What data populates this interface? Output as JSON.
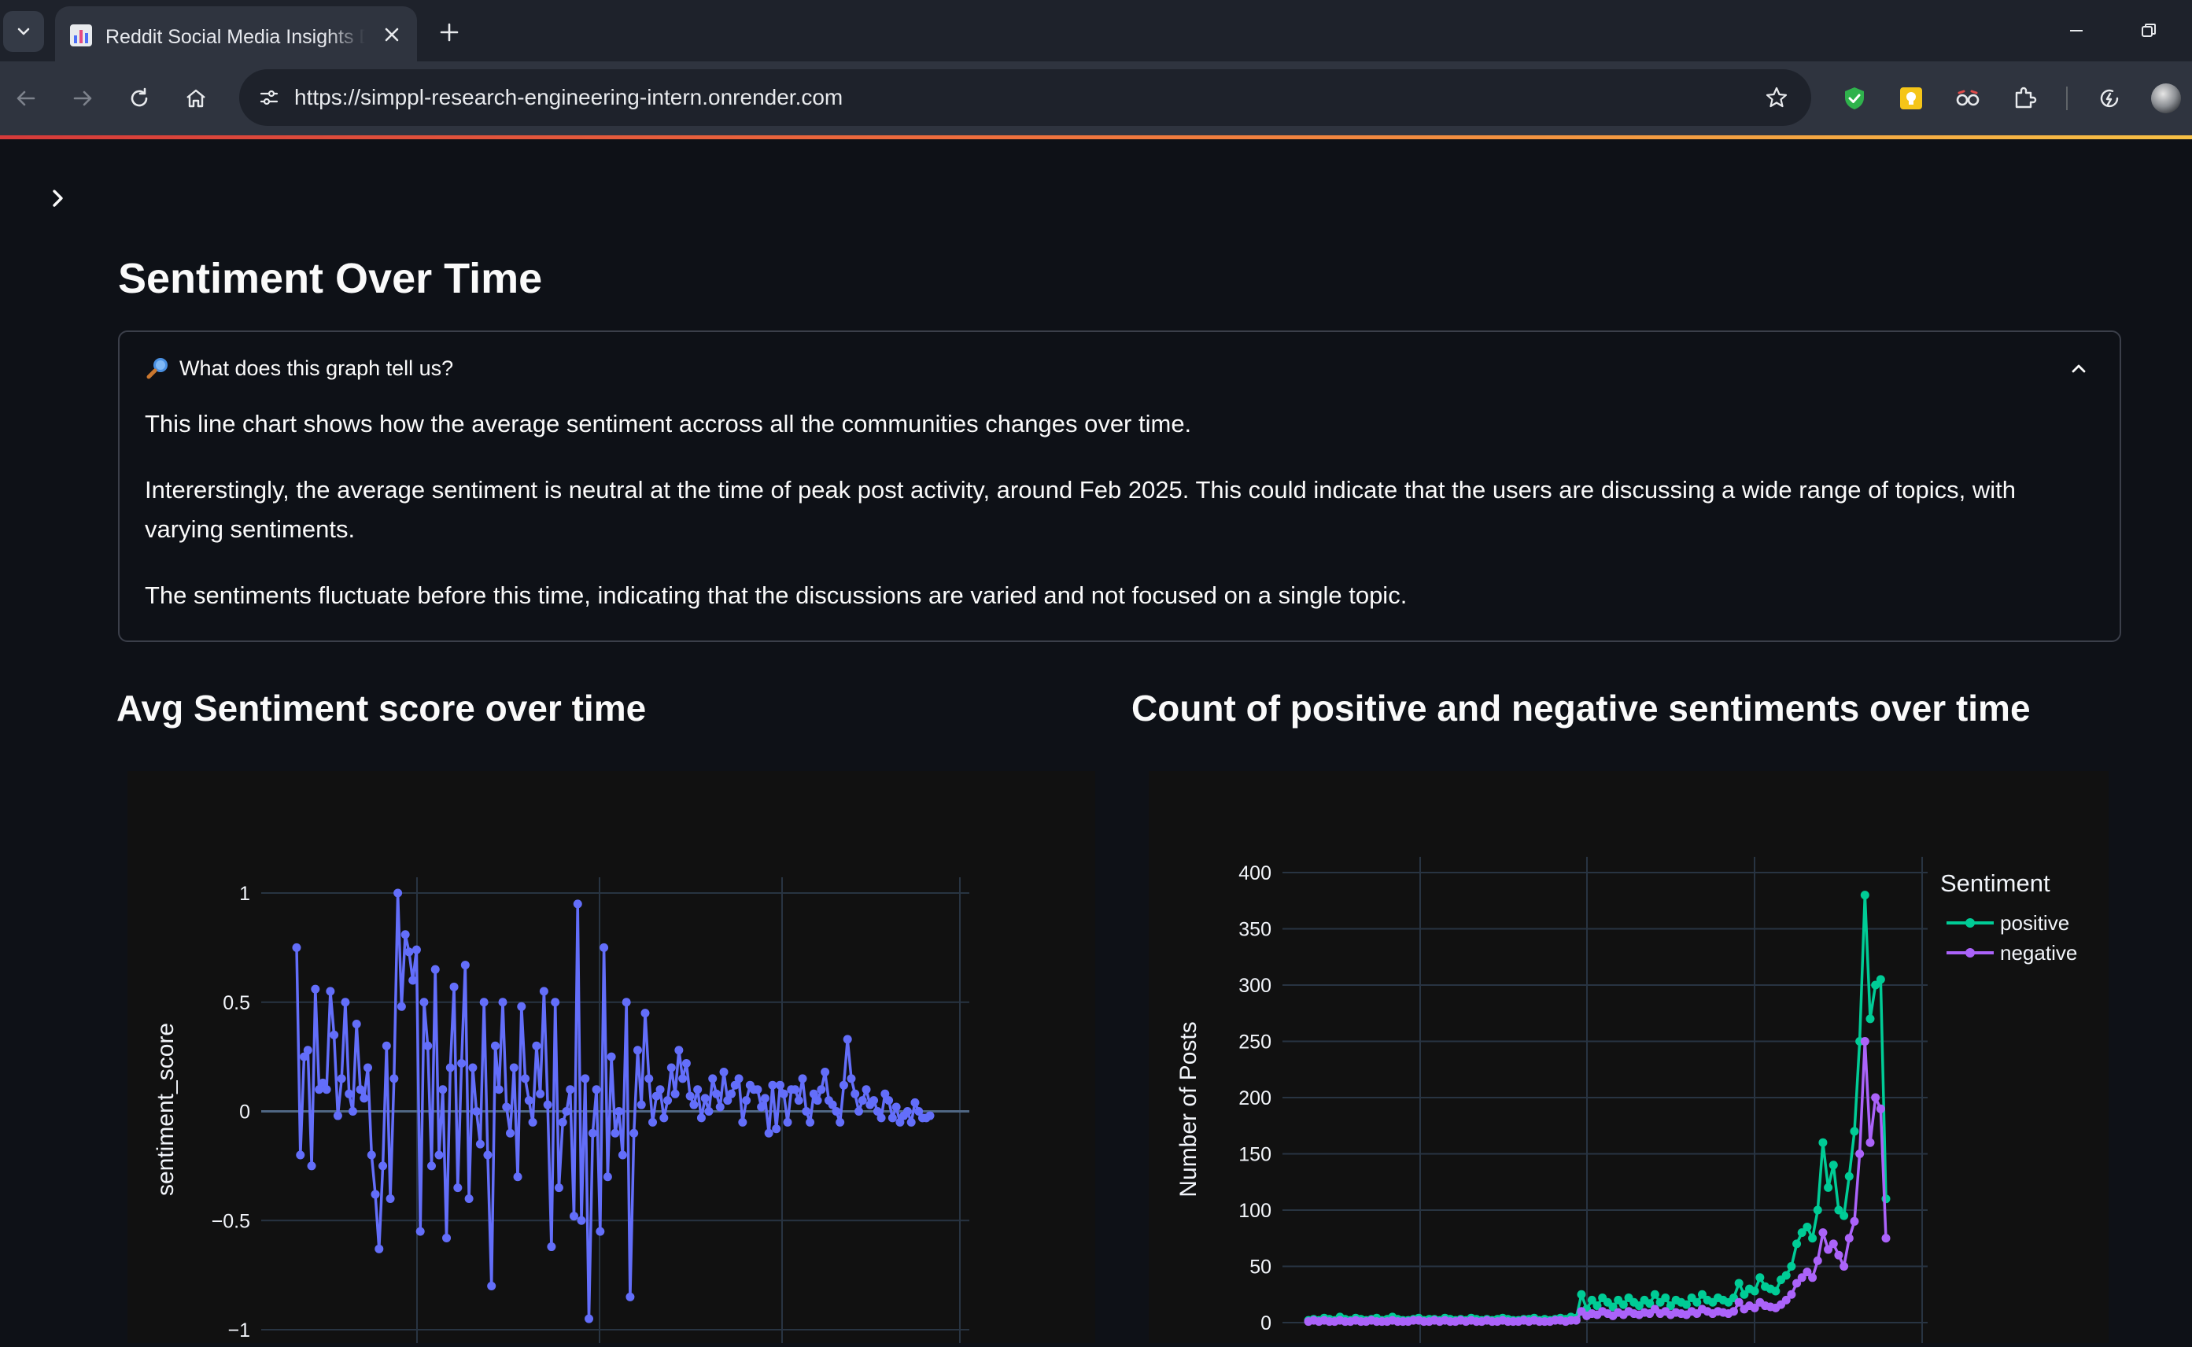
{
  "browser": {
    "tab_title": "Reddit Social Media Insights Da",
    "url": "https://simppl-research-engineering-intern.onrender.com"
  },
  "page": {
    "title": "Sentiment Over Time",
    "expander": {
      "label": "What does this graph tell us?",
      "paragraphs": [
        "This line chart shows how the average sentiment accross all the communities changes over time.",
        "Intererstingly, the average sentiment is neutral at the time of peak post activity, around Feb 2025. This could indicate that the users are discussing a wide range of topics, with varying sentiments.",
        "The sentiments fluctuate before this time, indicating that the discussions are varied and not focused on a single topic."
      ]
    },
    "left_chart_title": "Avg Sentiment score over time",
    "right_chart_title": "Count of positive and negative sentiments over time"
  },
  "colors": {
    "accent_blue": "#636efa",
    "positive": "#00cc96",
    "negative": "#ab63fa",
    "page_bg": "#0e1117",
    "panel_bg": "#111111"
  },
  "chart_data": [
    {
      "type": "line",
      "ylabel": "sentiment_score",
      "xlabel": "",
      "ylim": [
        -1,
        1
      ],
      "yticks": [
        1,
        0.5,
        0,
        -0.5,
        -1
      ],
      "ytick_labels": [
        "1",
        "0.5",
        "0",
        "−0.5",
        "−1"
      ],
      "grid": true,
      "series": [
        {
          "values": [
            0.75,
            -0.2,
            0.25,
            0.28,
            -0.25,
            0.56,
            0.1,
            0.13,
            0.1,
            0.55,
            0.35,
            -0.02,
            0.15,
            0.5,
            0.08,
            0.0,
            0.4,
            0.1,
            0.06,
            0.2,
            -0.2,
            -0.38,
            -0.63,
            -0.25,
            0.3,
            -0.4,
            0.15,
            1.0,
            0.48,
            0.81,
            0.73,
            0.6,
            0.74,
            -0.55,
            0.5,
            0.3,
            -0.25,
            0.65,
            -0.2,
            0.1,
            -0.58,
            0.2,
            0.57,
            -0.35,
            0.22,
            0.67,
            -0.4,
            0.2,
            0.0,
            -0.15,
            0.5,
            -0.2,
            -0.8,
            0.3,
            0.1,
            0.5,
            0.02,
            -0.1,
            0.2,
            -0.3,
            0.48,
            0.15,
            0.05,
            -0.05,
            0.3,
            0.08,
            0.55,
            0.03,
            -0.62,
            0.5,
            -0.35,
            -0.05,
            0.0,
            0.1,
            -0.48,
            0.95,
            -0.5,
            0.15,
            -0.95,
            -0.1,
            0.1,
            -0.55,
            0.75,
            -0.3,
            0.25,
            -0.1,
            0.0,
            -0.2,
            0.5,
            -0.85,
            -0.1,
            0.28,
            0.03,
            0.45,
            0.15,
            -0.05,
            0.07,
            0.1,
            -0.03,
            0.05,
            0.2,
            0.08,
            0.28,
            0.15,
            0.22,
            0.07,
            0.03,
            0.1,
            -0.03,
            0.06,
            0.0,
            0.15,
            0.08,
            0.02,
            0.18,
            0.05,
            0.08,
            0.12,
            0.15,
            -0.05,
            0.05,
            0.12,
            0.1,
            0.1,
            0.02,
            0.06,
            -0.1,
            0.12,
            -0.08,
            0.12,
            0.08,
            -0.05,
            0.1,
            0.1,
            0.05,
            0.15,
            0.0,
            -0.05,
            0.08,
            0.05,
            0.1,
            0.18,
            0.05,
            0.03,
            0.0,
            -0.05,
            0.12,
            0.33,
            0.15,
            0.08,
            0.0,
            0.05,
            0.1,
            0.03,
            0.05,
            0.0,
            -0.03,
            0.08,
            0.05,
            -0.03,
            0.02,
            -0.05,
            -0.02,
            0.0,
            -0.05,
            0.04,
            0.0,
            -0.03,
            -0.03,
            -0.02
          ]
        }
      ]
    },
    {
      "type": "line",
      "ylabel": "Number of Posts",
      "xlabel": "",
      "ylim": [
        0,
        400
      ],
      "yticks": [
        0,
        50,
        100,
        150,
        200,
        250,
        300,
        350,
        400
      ],
      "legend_title": "Sentiment",
      "legend_position": "top-right",
      "grid": true,
      "series": [
        {
          "name": "positive",
          "values": [
            2,
            3,
            2,
            4,
            3,
            2,
            5,
            3,
            2,
            4,
            3,
            2,
            3,
            4,
            2,
            3,
            5,
            3,
            2,
            2,
            3,
            4,
            2,
            3,
            3,
            2,
            4,
            3,
            2,
            3,
            2,
            4,
            3,
            2,
            3,
            2,
            3,
            4,
            3,
            2,
            2,
            3,
            3,
            4,
            2,
            3,
            2,
            3,
            4,
            3,
            5,
            4,
            25,
            12,
            20,
            15,
            22,
            18,
            14,
            20,
            16,
            22,
            18,
            15,
            20,
            17,
            25,
            18,
            22,
            15,
            20,
            18,
            16,
            22,
            18,
            25,
            20,
            18,
            22,
            20,
            18,
            22,
            35,
            25,
            30,
            28,
            40,
            32,
            30,
            28,
            38,
            42,
            50,
            70,
            80,
            85,
            75,
            100,
            160,
            120,
            140,
            100,
            95,
            130,
            170,
            250,
            380,
            270,
            300,
            305,
            110
          ]
        },
        {
          "name": "negative",
          "values": [
            1,
            2,
            1,
            2,
            1,
            1,
            2,
            1,
            1,
            2,
            1,
            1,
            2,
            1,
            1,
            1,
            2,
            1,
            1,
            1,
            2,
            2,
            1,
            1,
            2,
            1,
            2,
            1,
            1,
            2,
            1,
            2,
            1,
            1,
            2,
            1,
            1,
            2,
            1,
            1,
            1,
            2,
            1,
            2,
            1,
            1,
            1,
            2,
            2,
            1,
            2,
            2,
            10,
            6,
            8,
            7,
            10,
            8,
            6,
            9,
            7,
            10,
            8,
            7,
            9,
            8,
            12,
            8,
            10,
            7,
            9,
            8,
            7,
            10,
            8,
            12,
            10,
            8,
            10,
            9,
            8,
            10,
            18,
            12,
            15,
            13,
            18,
            15,
            14,
            13,
            16,
            20,
            25,
            35,
            40,
            45,
            40,
            55,
            80,
            65,
            70,
            60,
            50,
            75,
            90,
            150,
            250,
            160,
            200,
            190,
            75
          ]
        }
      ]
    }
  ]
}
